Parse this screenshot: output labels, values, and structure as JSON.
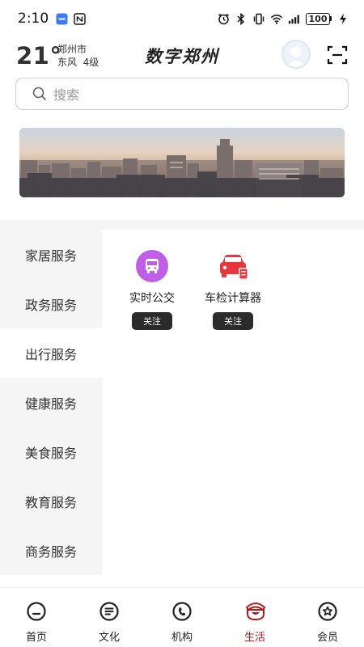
{
  "status_bar": {
    "time": "2:10",
    "battery": "100",
    "icons": [
      "notification-badge-icon",
      "nfc-icon",
      "alarm-icon",
      "bluetooth-icon",
      "vibrate-icon",
      "wifi-icon",
      "signal-icon",
      "charging-icon"
    ]
  },
  "header": {
    "temperature": "21°",
    "city": "郑州市",
    "wind": "东风  4级",
    "title": "数字郑州"
  },
  "search": {
    "placeholder": "搜索"
  },
  "categories": [
    {
      "label": "家居服务",
      "active": false
    },
    {
      "label": "政务服务",
      "active": false
    },
    {
      "label": "出行服务",
      "active": true
    },
    {
      "label": "健康服务",
      "active": false
    },
    {
      "label": "美食服务",
      "active": false
    },
    {
      "label": "教育服务",
      "active": false
    },
    {
      "label": "商务服务",
      "active": false
    }
  ],
  "services": [
    {
      "label": "实时公交",
      "follow": "关注",
      "icon": "bus-icon",
      "color": "#c05ee8"
    },
    {
      "label": "车检计算器",
      "follow": "关注",
      "icon": "car-calculator-icon",
      "color": "#e8363b"
    }
  ],
  "bottom_nav": [
    {
      "label": "首页",
      "icon": "home-icon",
      "active": false
    },
    {
      "label": "文化",
      "icon": "culture-icon",
      "active": false
    },
    {
      "label": "机构",
      "icon": "institution-icon",
      "active": false
    },
    {
      "label": "生活",
      "icon": "life-icon",
      "active": true
    },
    {
      "label": "会员",
      "icon": "member-icon",
      "active": false
    }
  ],
  "colors": {
    "accent": "#b11d1d",
    "menu_bg": "#f5f5f5",
    "follow_bg": "#2b2b2b"
  }
}
